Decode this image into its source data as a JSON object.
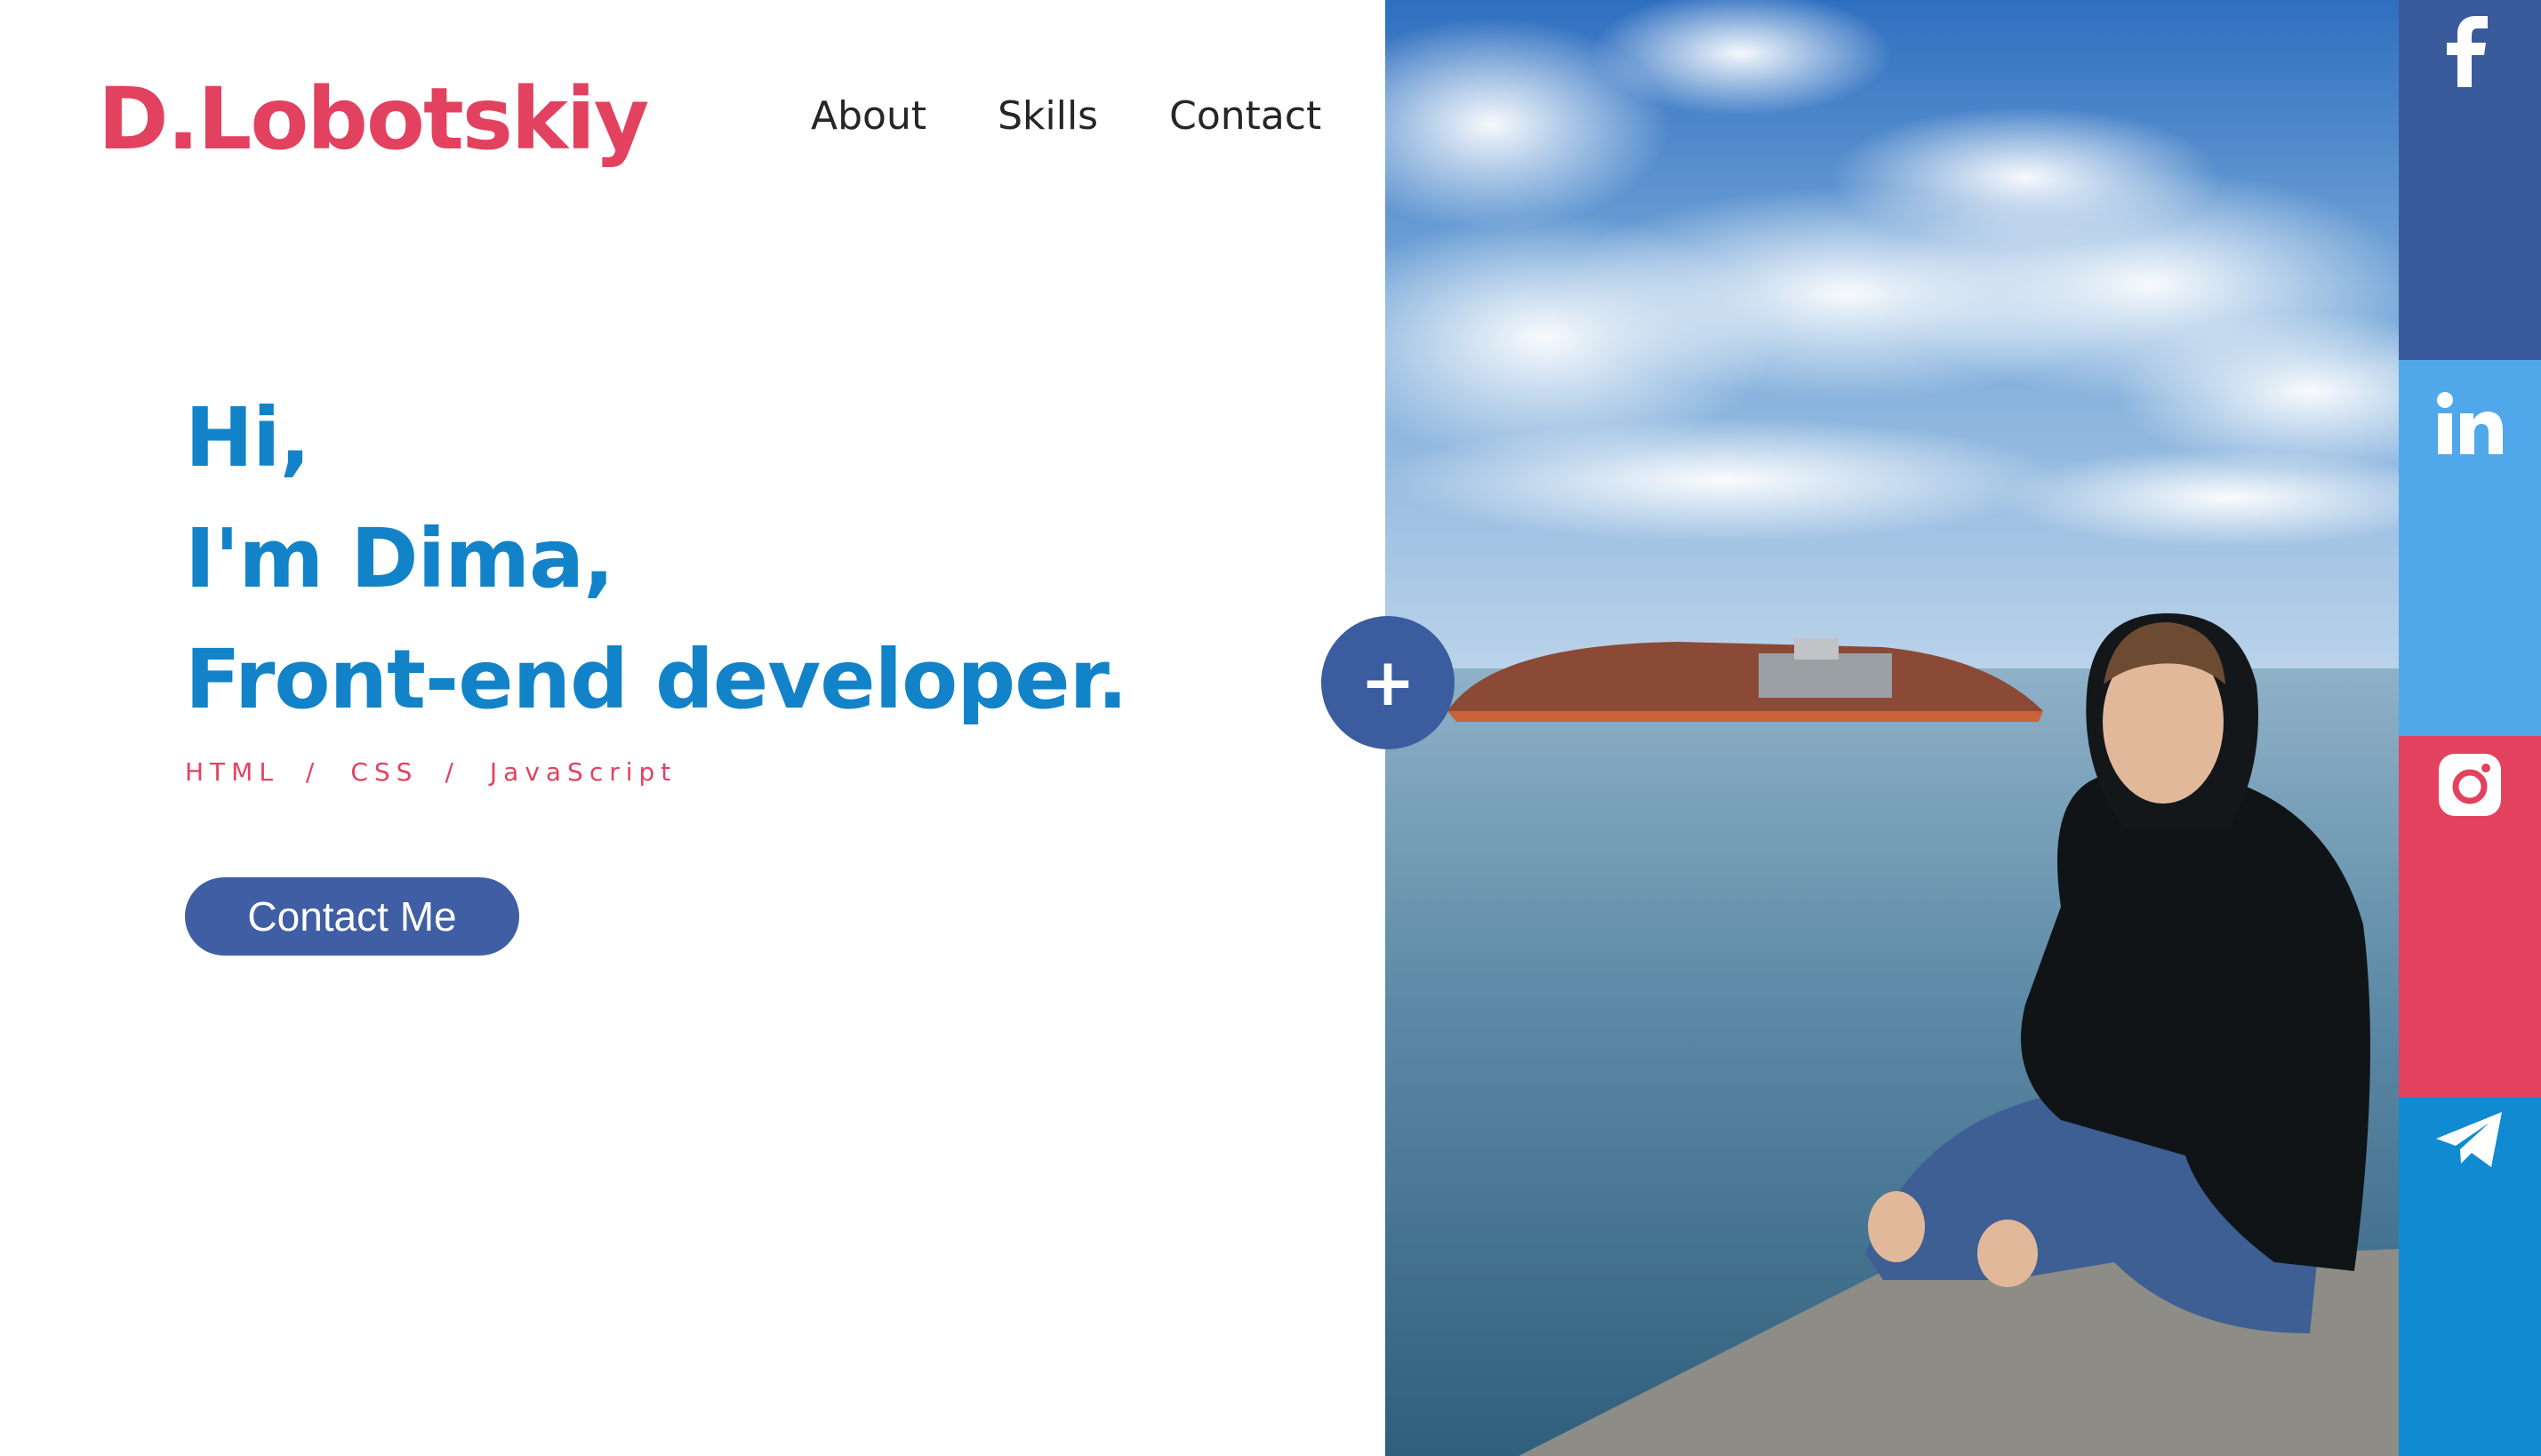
{
  "header": {
    "logo": "D.Lobotskiy",
    "nav": [
      "About",
      "Skills",
      "Contact"
    ]
  },
  "hero": {
    "lines": [
      "Hi,",
      "I'm Dima,",
      "Front-end developer."
    ],
    "tech": [
      "HTML",
      "CSS",
      "JavaScript"
    ],
    "tech_separator": "/",
    "cta_label": "Contact Me"
  },
  "plus_button": {
    "label": "+"
  },
  "social": [
    {
      "name": "facebook",
      "icon": "facebook-icon",
      "color": "#3a5b9b"
    },
    {
      "name": "linkedin",
      "icon": "linkedin-icon",
      "color": "#50a8ea"
    },
    {
      "name": "instagram",
      "icon": "instagram-icon",
      "color": "#e3425e"
    },
    {
      "name": "telegram",
      "icon": "telegram-icon",
      "color": "#108ad0"
    }
  ],
  "colors": {
    "accent_red": "#e2425f",
    "heading_blue": "#1283c8",
    "button_blue": "#3f5ea3"
  }
}
